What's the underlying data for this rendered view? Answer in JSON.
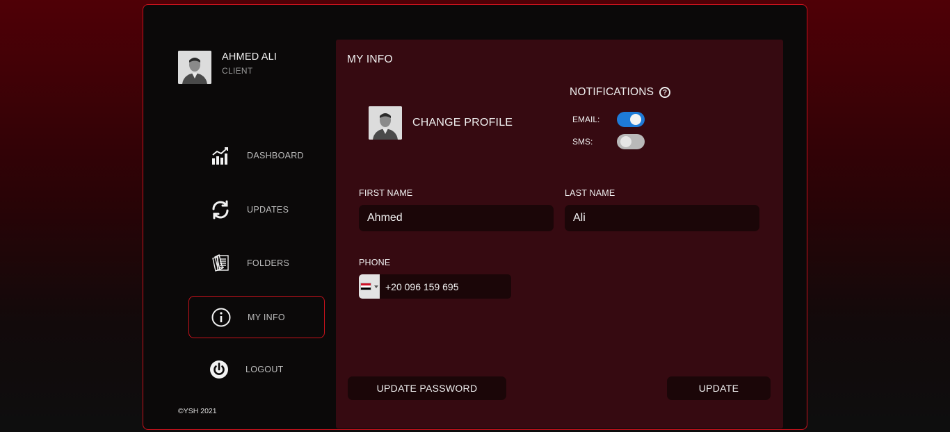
{
  "user": {
    "name": "AHMED ALI",
    "role": "CLIENT"
  },
  "nav": [
    {
      "label": "DASHBOARD",
      "icon": "chart-growth-icon",
      "active": false
    },
    {
      "label": "UPDATES",
      "icon": "refresh-icon",
      "active": false
    },
    {
      "label": "FOLDERS",
      "icon": "documents-icon",
      "active": false
    },
    {
      "label": "MY INFO",
      "icon": "info-icon",
      "active": true
    },
    {
      "label": "LOGOUT",
      "icon": "power-icon",
      "active": false
    }
  ],
  "footer": {
    "copyright": "©YSH 2021"
  },
  "panel": {
    "title": "MY INFO",
    "change_profile": "CHANGE PROFILE",
    "notifications": {
      "title": "NOTIFICATIONS",
      "email_label": "EMAIL:",
      "email_enabled": true,
      "sms_label": "SMS:",
      "sms_enabled": false
    },
    "form": {
      "first_name_label": "FIRST NAME",
      "first_name_value": "Ahmed",
      "last_name_label": "LAST NAME",
      "last_name_value": "Ali",
      "phone_label": "PHONE",
      "phone_value": "+20 096 159 695",
      "phone_country": "Egypt"
    },
    "buttons": {
      "update_password": "UPDATE PASSWORD",
      "update": "UPDATE"
    }
  },
  "colors": {
    "accent_border": "#c8121c",
    "panel_bg": "#360a11",
    "toggle_on": "#1e7bd8",
    "toggle_off": "#b9b9b9"
  }
}
